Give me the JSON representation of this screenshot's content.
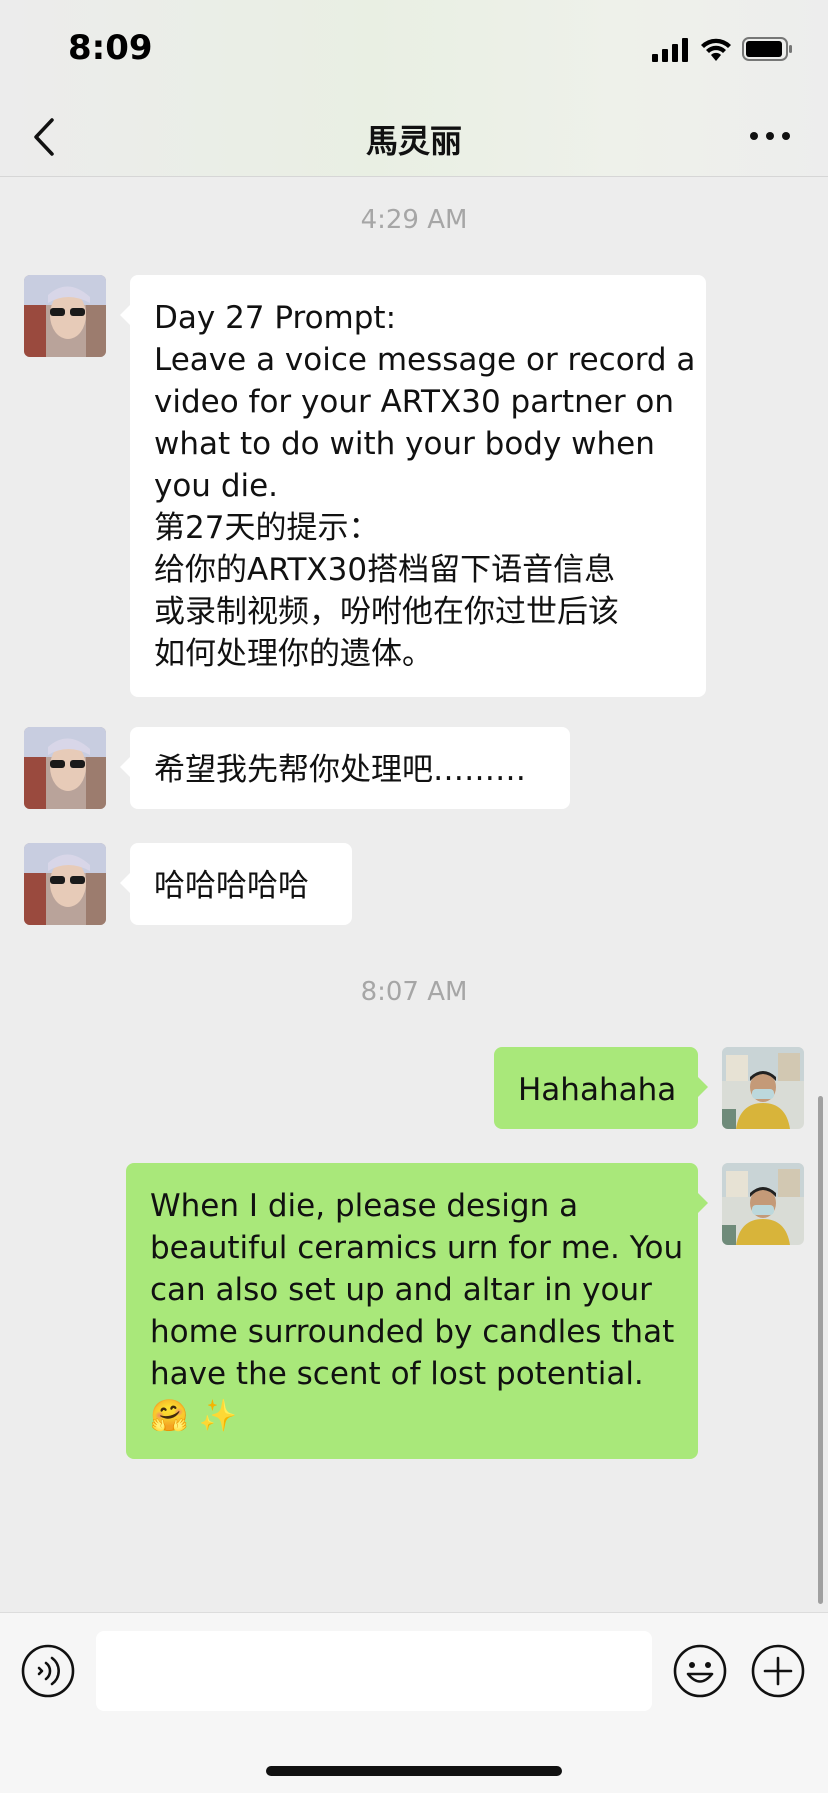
{
  "status_bar": {
    "time": "8:09"
  },
  "header": {
    "title": "馬灵丽"
  },
  "chat": {
    "timestamp_1": "4:29 AM",
    "timestamp_2": "8:07 AM",
    "messages": [
      {
        "side": "left",
        "lines": [
          "Day 27 Prompt:",
          "Leave a voice message or record a",
          "video for your ARTX30 partner on",
          "what to do with your body when",
          "you die.",
          "第27天的提示：",
          "给你的ARTX30搭档留下语音信息",
          "或录制视频，吩咐他在你过世后该",
          "如何处理你的遗体。"
        ]
      },
      {
        "side": "left",
        "text": "希望我先帮你处理吧………"
      },
      {
        "side": "left",
        "text": "哈哈哈哈哈"
      },
      {
        "side": "right",
        "text": "Hahahaha"
      },
      {
        "side": "right",
        "lines": [
          "When I die, please design a",
          "beautiful ceramics urn for me. You",
          "can also set up and altar in your",
          "home surrounded by candles that",
          "have the scent of lost potential.",
          "🤗 ✨"
        ]
      }
    ]
  },
  "input_bar": {
    "placeholder": ""
  },
  "colors": {
    "sent_bubble": "#a9e87a",
    "received_bubble": "#ffffff",
    "background": "#ededed"
  }
}
